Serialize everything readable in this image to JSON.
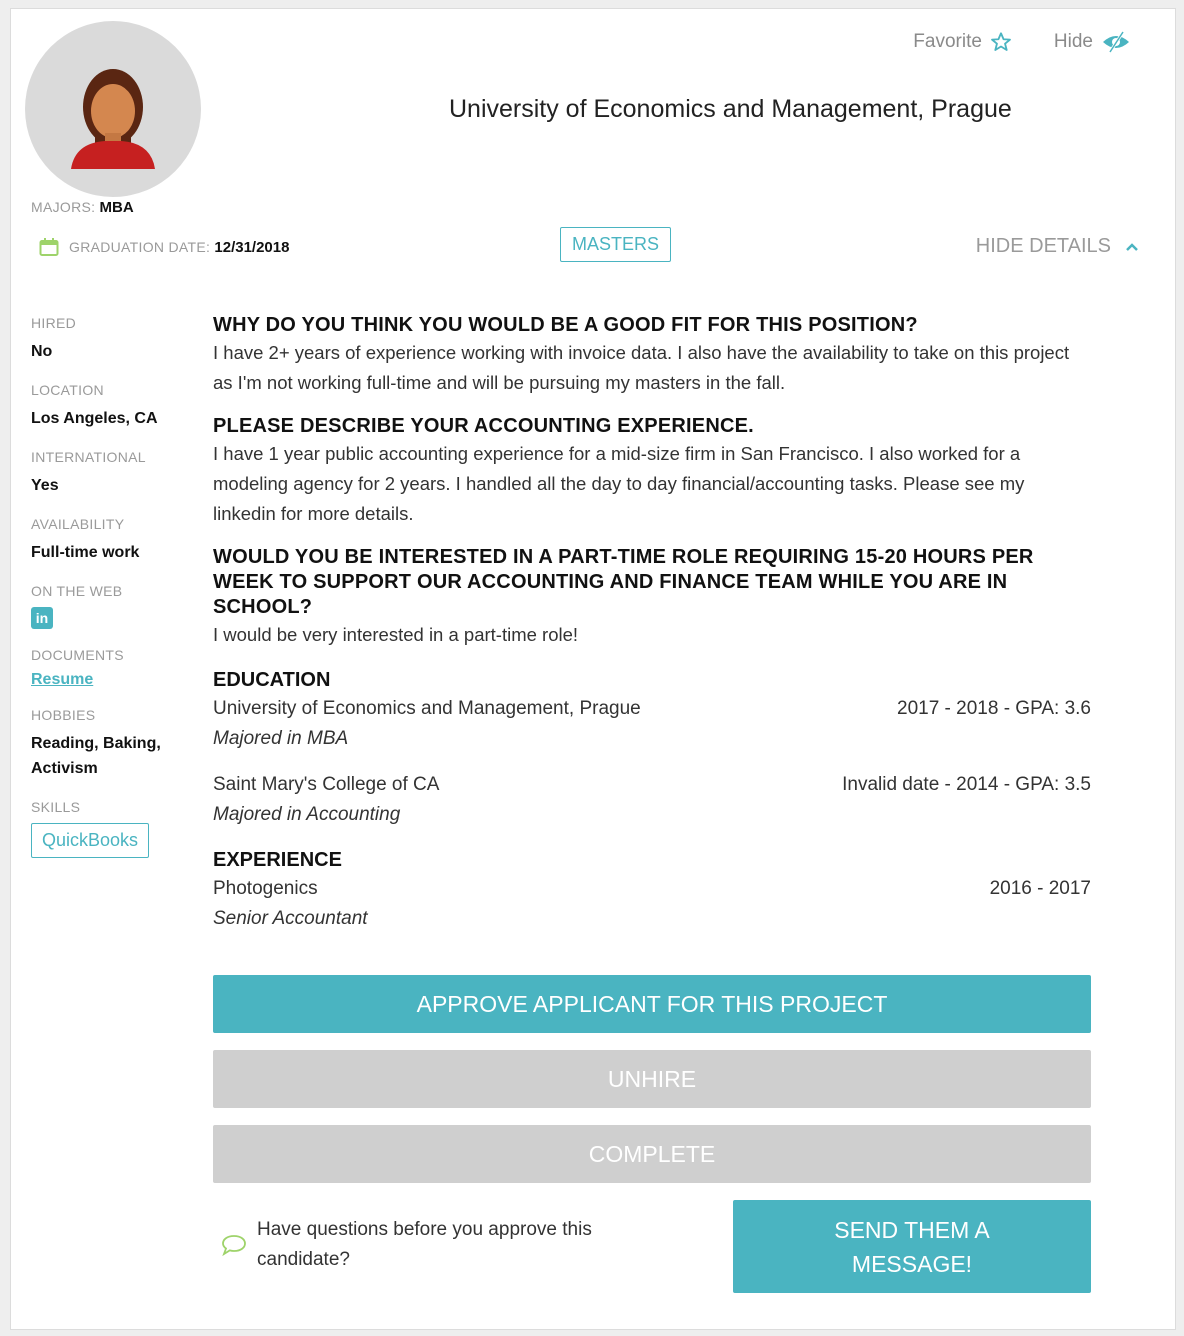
{
  "header": {
    "favorite_label": "Favorite",
    "hide_label": "Hide",
    "university": "University of Economics and Management, Prague",
    "majors_label": "MAJORS:",
    "majors_value": "MBA",
    "graduation_label": "GRADUATION DATE:",
    "graduation_value": "12/31/2018",
    "degree_badge": "MASTERS",
    "hide_details_label": "HIDE DETAILS"
  },
  "sidebar": {
    "hired_label": "HIRED",
    "hired_value": "No",
    "location_label": "LOCATION",
    "location_value": "Los Angeles, CA",
    "international_label": "INTERNATIONAL",
    "international_value": "Yes",
    "availability_label": "AVAILABILITY",
    "availability_value": "Full-time work",
    "web_label": "ON THE WEB",
    "linkedin_glyph": "in",
    "documents_label": "DOCUMENTS",
    "resume_link": "Resume",
    "hobbies_label": "HOBBIES",
    "hobbies_value": "Reading, Baking, Activism",
    "skills_label": "SKILLS",
    "skills": [
      "QuickBooks"
    ]
  },
  "questions": [
    {
      "q": "WHY DO YOU THINK YOU WOULD BE A GOOD FIT FOR THIS POSITION?",
      "a": "I have 2+ years of experience working with invoice data. I also have the availability to take on this project as I'm not working full-time and will be pursuing my masters in the fall."
    },
    {
      "q": "PLEASE DESCRIBE YOUR ACCOUNTING EXPERIENCE.",
      "a": "I have 1 year public accounting experience for a mid-size firm in San Francisco. I also worked for a modeling agency for 2 years. I handled all the day to day financial/accounting tasks. Please see my linkedin for more details."
    },
    {
      "q": "WOULD YOU BE INTERESTED IN A PART-TIME ROLE REQUIRING 15-20 HOURS PER WEEK TO SUPPORT OUR ACCOUNTING AND FINANCE TEAM WHILE YOU ARE IN SCHOOL?",
      "a": "I would be very interested in a part-time role!"
    }
  ],
  "education": {
    "title": "EDUCATION",
    "items": [
      {
        "school": "University of Economics and Management, Prague",
        "dates": "2017 - 2018 - GPA: 3.6",
        "major": "Majored in MBA"
      },
      {
        "school": "Saint Mary's College of CA",
        "dates": "Invalid date - 2014 - GPA: 3.5",
        "major": "Majored in Accounting"
      }
    ]
  },
  "experience": {
    "title": "EXPERIENCE",
    "items": [
      {
        "company": "Photogenics",
        "dates": "2016 - 2017",
        "role": "Senior Accountant"
      }
    ]
  },
  "actions": {
    "approve": "APPROVE APPLICANT FOR THIS PROJECT",
    "unhire": "UNHIRE",
    "complete": "COMPLETE",
    "question_prompt": "Have questions before you approve this candidate?",
    "message": "SEND THEM A MESSAGE!"
  },
  "colors": {
    "accent": "#4ab4c1",
    "disabled": "#cfcfcf",
    "muted_text": "#9a9a9a"
  }
}
